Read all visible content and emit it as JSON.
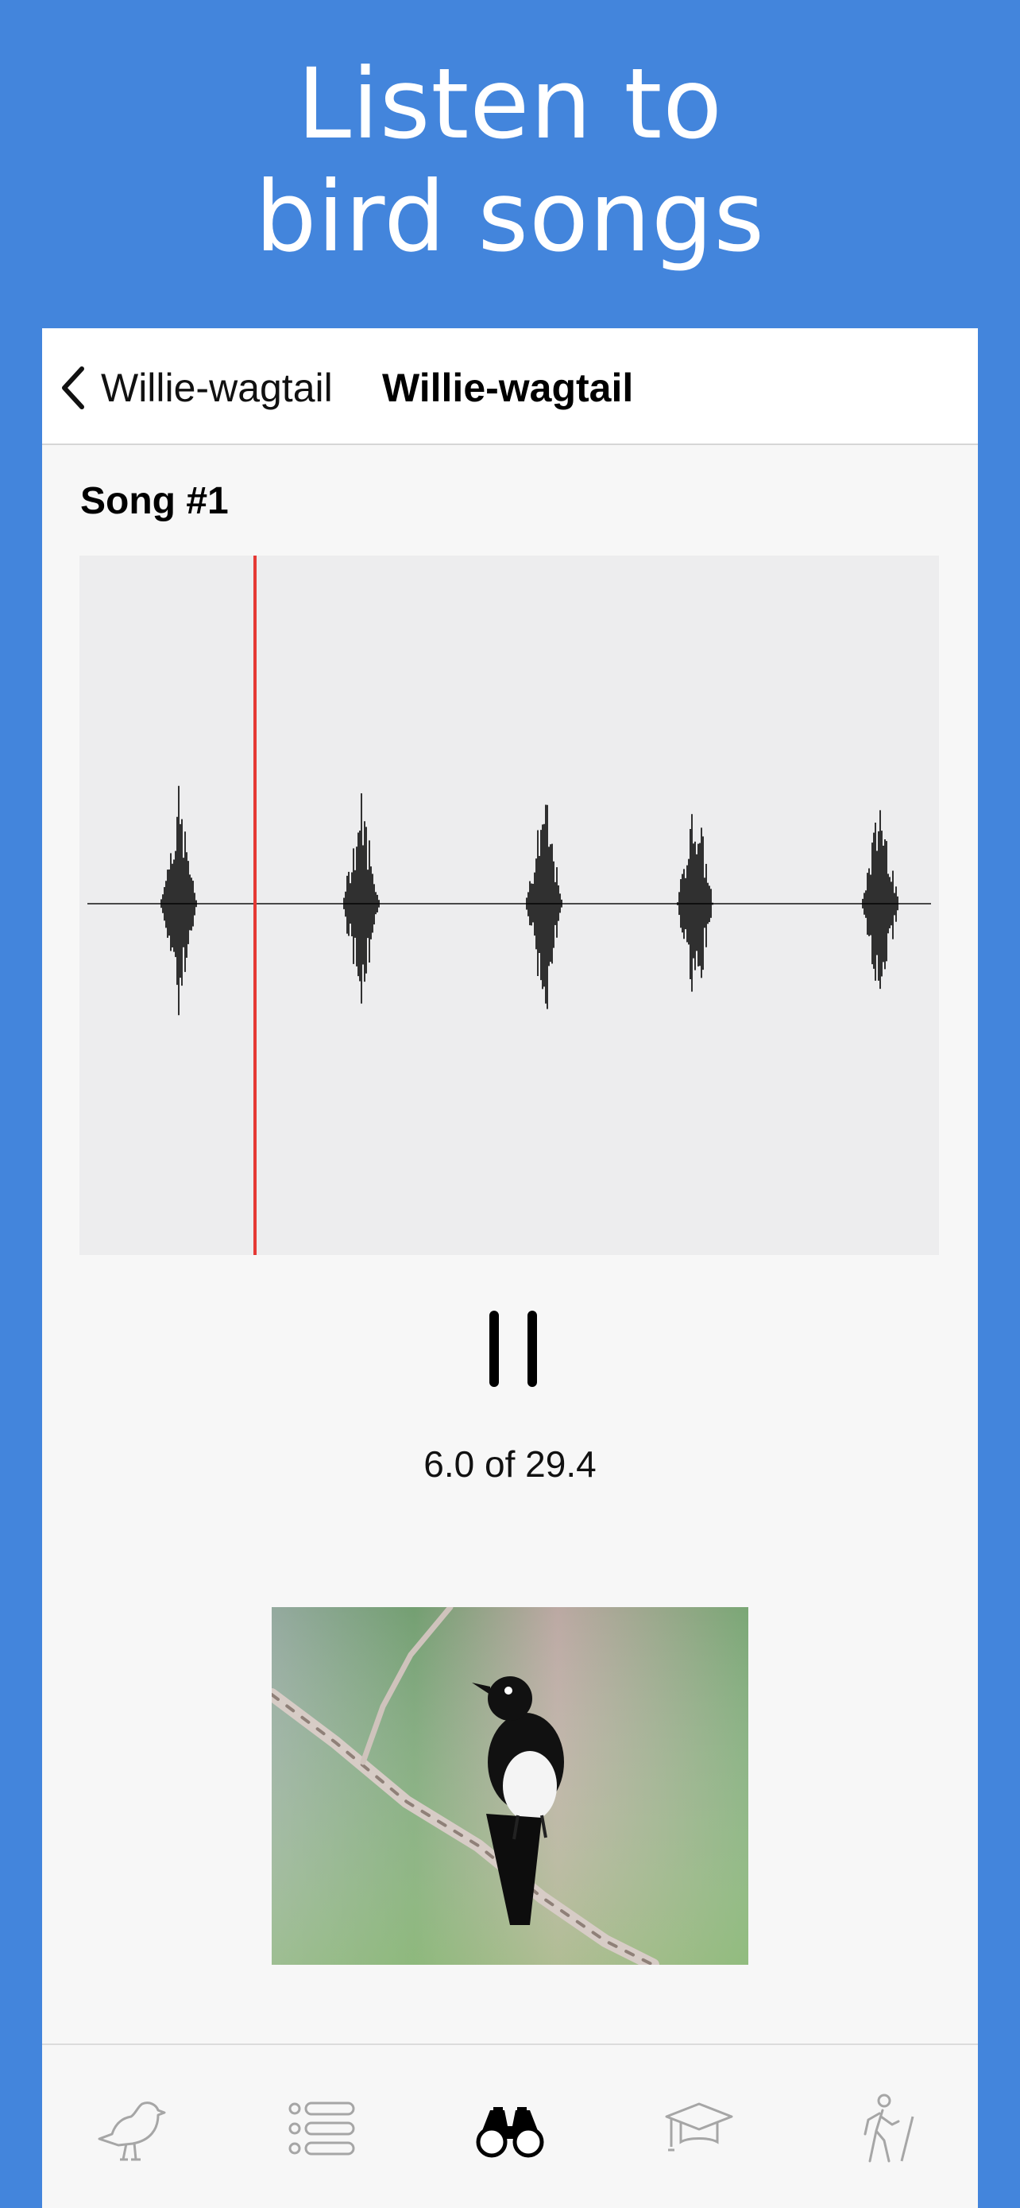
{
  "hero": {
    "line1": "Listen to",
    "line2": "bird songs"
  },
  "navbar": {
    "back_label": "Willie-wagtail",
    "title": "Willie-wagtail"
  },
  "song": {
    "title": "Song #1",
    "time_label": "6.0 of 29.4",
    "position": 6.0,
    "duration": 29.4
  },
  "photo": {
    "subject": "Willie-wagtail perched on branch"
  },
  "tabs": [
    {
      "icon": "bird-icon",
      "active": false
    },
    {
      "icon": "list-icon",
      "active": false
    },
    {
      "icon": "binoculars-icon",
      "active": true
    },
    {
      "icon": "graduation-cap-icon",
      "active": false
    },
    {
      "icon": "hiker-icon",
      "active": false
    }
  ],
  "colors": {
    "background": "#4385dc",
    "playhead": "#e53935",
    "active_tab": "#000000",
    "inactive_tab": "#a6a6a6"
  }
}
